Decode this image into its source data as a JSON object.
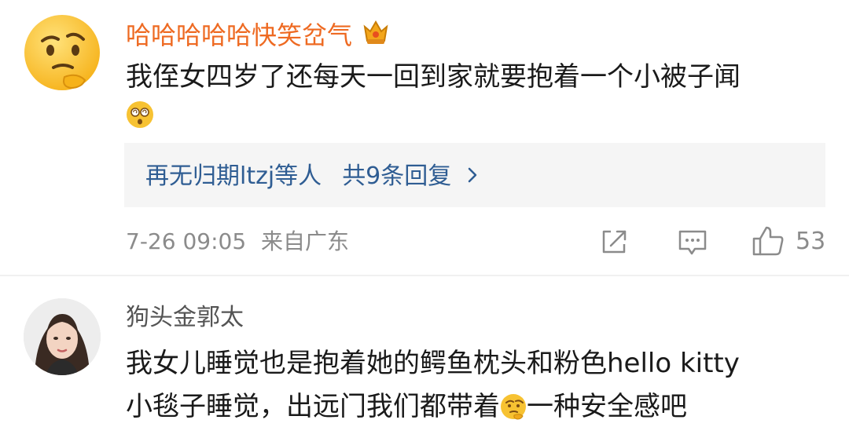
{
  "comment1": {
    "username": "哈哈哈哈哈快笑岔气",
    "badge_icon": "crown-badge-icon",
    "text_line1": "我侄女四岁了还每天一回到家就要抱着一个小被子闻",
    "text_line2_emoji": "dizzy-face-emoji",
    "replies": {
      "label": "再无归期ltzj等人",
      "count_label": "共9条回复",
      "chevron": "chevron-right-icon"
    },
    "timestamp": "7-26 09:05",
    "location": "来自广东",
    "like_count": "53"
  },
  "comment2": {
    "username": "狗头金郭太",
    "text_line1": "我女儿睡觉也是抱着她的鳄鱼枕头和粉色hello kitty",
    "text_line2_before": "小毯子睡觉，出远门我们都带着",
    "text_line2_emoji": "thinking-face-emoji",
    "text_line2_after": "一种安全感吧"
  },
  "colors": {
    "username_highlight": "#ee6a22",
    "link_blue": "#2f5d93",
    "meta_grey": "#8b8b8b",
    "reply_bg": "#f5f5f5"
  }
}
